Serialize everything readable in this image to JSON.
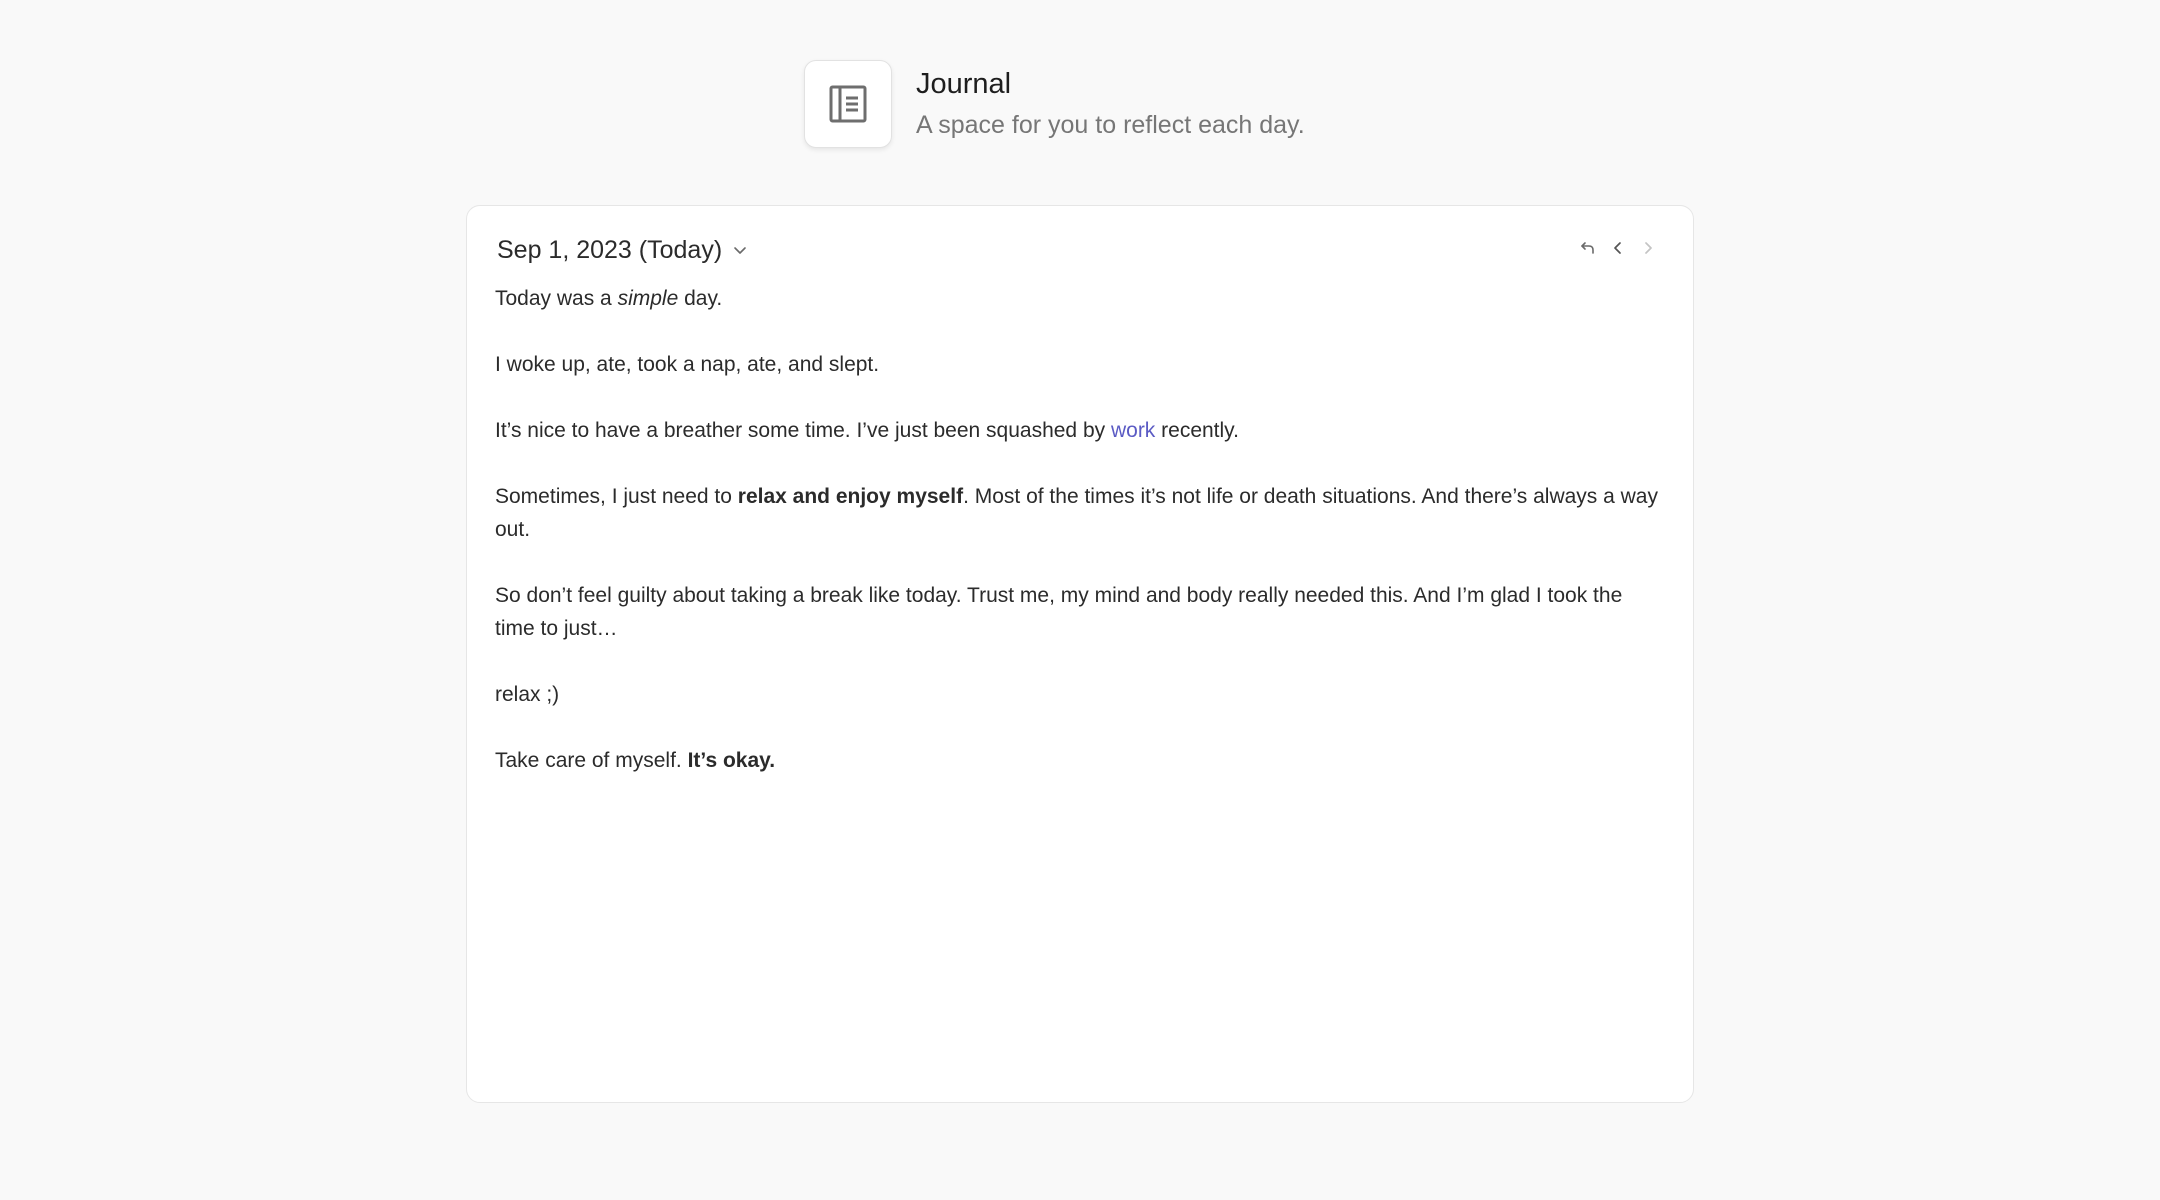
{
  "header": {
    "icon": "journal-icon",
    "title": "Journal",
    "subtitle": "A space for you to reflect each day."
  },
  "toolbar": {
    "date_label": "Sep 1, 2023 (Today)",
    "dropdown_icon": "chevron-down-icon",
    "nav_icons": [
      "return-icon",
      "chevron-left-icon",
      "chevron-right-icon"
    ]
  },
  "entry": {
    "p1": {
      "before": "Today was a ",
      "em": "simple",
      "after": " day."
    },
    "p2": "I woke up, ate, took a nap, ate, and slept.",
    "p3": {
      "before": "It’s nice to have a breather some time. I’ve just been squashed by ",
      "link": "work",
      "after": " recently."
    },
    "p4": {
      "before": "Sometimes, I just need to ",
      "strong": "relax and enjoy myself",
      "after": ". Most of the times it’s not life or death situations. And there’s always a way out."
    },
    "p5": "So don’t feel guilty about taking a break like today. Trust me, my mind and body really needed this. And I’m glad I took the time to just…",
    "p6": "relax ;)",
    "p7": {
      "before": "Take care of myself. ",
      "strong": "It’s okay."
    }
  },
  "colors": {
    "background": "#f9f9f9",
    "card": "#ffffff",
    "link": "#5b5bc4",
    "text": "#2b2b2b",
    "muted": "#767676"
  }
}
